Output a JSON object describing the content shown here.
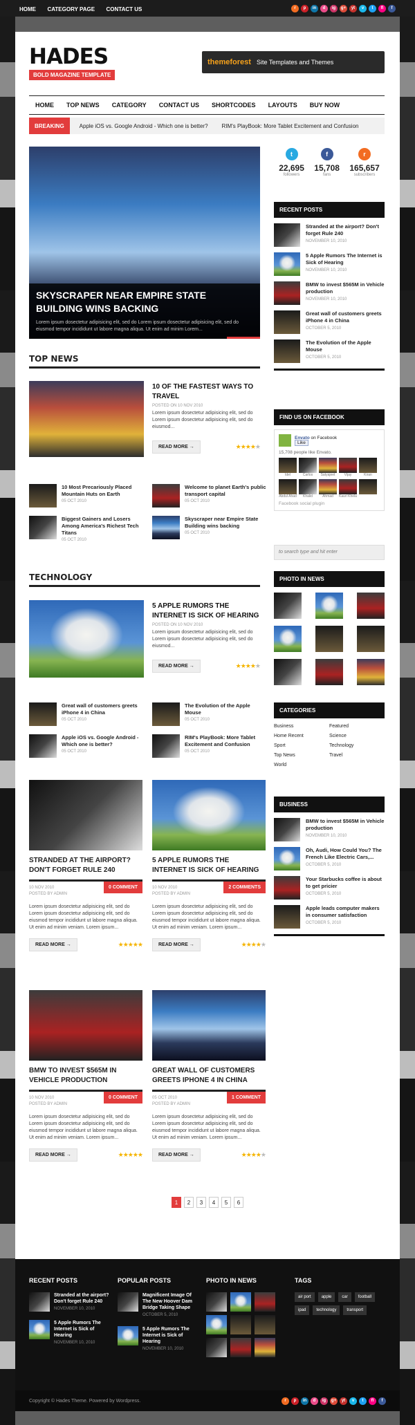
{
  "topbar": {
    "links": [
      "HOME",
      "CATEGORY PAGE",
      "CONTACT US"
    ]
  },
  "social_icons": [
    {
      "name": "rss-icon",
      "glyph": "r",
      "color": "#f26c22"
    },
    {
      "name": "pinterest-icon",
      "glyph": "p",
      "color": "#cb2027"
    },
    {
      "name": "linkedin-icon",
      "glyph": "in",
      "color": "#0e76a8"
    },
    {
      "name": "dribbble-icon",
      "glyph": "d",
      "color": "#ea4c89"
    },
    {
      "name": "instagram-icon",
      "glyph": "ig",
      "color": "#cc3366"
    },
    {
      "name": "googleplus-icon",
      "glyph": "g+",
      "color": "#dd4b39"
    },
    {
      "name": "youtube-icon",
      "glyph": "yt",
      "color": "#c4302b"
    },
    {
      "name": "vimeo-icon",
      "glyph": "v",
      "color": "#1ab7ea"
    },
    {
      "name": "twitter-icon",
      "glyph": "t",
      "color": "#1da1f2"
    },
    {
      "name": "flickr-icon",
      "glyph": "fl",
      "color": "#ff0084"
    },
    {
      "name": "facebook-icon",
      "glyph": "f",
      "color": "#3b5998"
    }
  ],
  "logo": {
    "title": "HADES",
    "tagline": "BOLD MAGAZINE TEMPLATE"
  },
  "banner": {
    "brand": "themeforest",
    "text": "Site Templates and Themes"
  },
  "nav": [
    "HOME",
    "TOP NEWS",
    "CATEGORY",
    "CONTACT US",
    "SHORTCODES",
    "LAYOUTS",
    "BUY NOW"
  ],
  "breaking": {
    "label": "BREAKING",
    "items": [
      "Apple iOS vs. Google Android - Which one is better?",
      "RIM's PlayBook: More Tablet Excitement and Confusion"
    ]
  },
  "hero": {
    "title": "SKYSCRAPER NEAR EMPIRE STATE BUILDING WINS BACKING",
    "text": "Lorem ipsum dosectetur adipisicing elit, sed do Lorem ipsum dosectetur adipisicing elit, sed do eiusmod tempor incididunt ut labore magna aliqua. Ut enim ad minim Lorem..."
  },
  "counts": [
    {
      "icon": "t",
      "value": "22,695",
      "label": "followers",
      "color": "#29a9e1"
    },
    {
      "icon": "f",
      "value": "15,708",
      "label": "fans",
      "color": "#3b5998"
    },
    {
      "icon": "r",
      "value": "165,657",
      "label": "subscribers",
      "color": "#f26c22"
    }
  ],
  "top_news": {
    "heading": "TOP NEWS",
    "feature": {
      "title": "10 OF THE FASTEST WAYS TO TRAVEL",
      "date": "POSTED ON 10 NOV 2010",
      "text": "Lorem ipsum dosectetur adipisicing elit, sed do Lorem ipsum dosectetur adipisicing elit, sed do eiusmod...",
      "readmore": "READ MORE →",
      "rating": 4
    },
    "minis": [
      {
        "title": "10 Most Precariously Placed Mountain Huts on Earth",
        "date": "05 OCT 2010"
      },
      {
        "title": "Welcome to planet Earth's public transport capital",
        "date": "05 OCT 2010"
      },
      {
        "title": "Biggest Gainers and Losers Among America's Richest Tech Titans",
        "date": "05 OCT 2010"
      },
      {
        "title": "Skyscraper near Empire State Building wins backing",
        "date": "05 OCT 2010"
      }
    ]
  },
  "technology": {
    "heading": "TECHNOLOGY",
    "feature": {
      "title": "5 APPLE RUMORS THE INTERNET IS SICK OF HEARING",
      "date": "POSTED ON 10 NOV 2010",
      "text": "Lorem ipsum dosectetur adipisicing elit, sed do Lorem ipsum dosectetur adipisicing elit, sed do eiusmod...",
      "readmore": "READ MORE →",
      "rating": 4
    },
    "minis": [
      {
        "title": "Great wall of customers greets iPhone 4 in China",
        "date": "05 OCT 2010"
      },
      {
        "title": "The Evolution of the Apple Mouse",
        "date": "05 OCT 2010"
      },
      {
        "title": "Apple iOS vs. Google Android - Which one is better?",
        "date": "05 OCT 2010"
      },
      {
        "title": "RIM's PlayBook: More Tablet Excitement and Confusion",
        "date": "05 OCT 2010"
      }
    ]
  },
  "cards": [
    {
      "title": "STRANDED AT THE AIRPORT? DON'T FORGET RULE 240",
      "date": "10 NOV 2010",
      "author": "POSTED BY ADMIN",
      "comments": "0 COMMENT",
      "text": "Lorem ipsum dosectetur adipisicing elit, sed do Lorem ipsum dosectetur adipisicing elit, sed do eiusmod tempor incididunt ut labore magna aliqua. Ut enim ad minim veniam. Lorem ipsum...",
      "readmore": "READ MORE →",
      "rating": 5
    },
    {
      "title": "5 APPLE RUMORS THE INTERNET IS SICK OF HEARING",
      "date": "10 NOV 2010",
      "author": "POSTED BY ADMIN",
      "comments": "2 COMMENTS",
      "text": "Lorem ipsum dosectetur adipisicing elit, sed do Lorem ipsum dosectetur adipisicing elit, sed do eiusmod tempor incididunt ut labore magna aliqua. Ut enim ad minim veniam. Lorem ipsum...",
      "readmore": "READ MORE →",
      "rating": 4
    },
    {
      "title": "BMW TO INVEST $565M IN VEHICLE PRODUCTION",
      "date": "10 NOV 2010",
      "author": "POSTED BY ADMIN",
      "comments": "0 COMMENT",
      "text": "Lorem ipsum dosectetur adipisicing elit, sed do Lorem ipsum dosectetur adipisicing elit, sed do eiusmod tempor incididunt ut labore magna aliqua. Ut enim ad minim veniam. Lorem ipsum...",
      "readmore": "READ MORE →",
      "rating": 5
    },
    {
      "title": "GREAT WALL OF CUSTOMERS GREETS IPHONE 4 IN CHINA",
      "date": "05 OCT 2010",
      "author": "POSTED BY ADMIN",
      "comments": "1 COMMENT",
      "text": "Lorem ipsum dosectetur adipisicing elit, sed do Lorem ipsum dosectetur adipisicing elit, sed do eiusmod tempor incididunt ut labore magna aliqua. Ut enim ad minim veniam. Lorem ipsum...",
      "readmore": "READ MORE →",
      "rating": 4
    }
  ],
  "pagination": [
    "1",
    "2",
    "3",
    "4",
    "5",
    "6"
  ],
  "sidebar": {
    "recent": {
      "heading": "RECENT POSTS",
      "items": [
        {
          "title": "Stranded at the airport? Don't forget Rule 240",
          "date": "NOVEMBER 10, 2010"
        },
        {
          "title": "5 Apple Rumors The Internet is Sick of Hearing",
          "date": "NOVEMBER 10, 2010"
        },
        {
          "title": "BMW to invest $565M in Vehicle production",
          "date": "NOVEMBER 10, 2010"
        },
        {
          "title": "Great wall of customers greets iPhone 4 in China",
          "date": "OCTOBER 5, 2010"
        },
        {
          "title": "The Evolution of the Apple Mouse",
          "date": "OCTOBER 5, 2010"
        }
      ]
    },
    "facebook": {
      "heading": "FIND US ON FACEBOOK",
      "page": "Envato",
      "sub": "on Facebook",
      "like": "Like",
      "people": "15,708 people like Envato.",
      "names": [
        "Idel",
        "Carlos",
        "Satyajeet",
        "Vijay",
        "Kiran",
        "Abdul Ahad",
        "Khalid",
        "Ahmad",
        "Kauri Khela",
        ""
      ],
      "plugin": "Facebook social plugin"
    },
    "search": {
      "placeholder": "to search type and hit enter"
    },
    "photos": {
      "heading": "PHOTO IN NEWS"
    },
    "categories": {
      "heading": "CATEGORIES",
      "items": [
        "Business",
        "Featured",
        "Home Recent",
        "Science",
        "Sport",
        "Technology",
        "Top News",
        "Travel",
        "World"
      ]
    },
    "business": {
      "heading": "BUSINESS",
      "items": [
        {
          "title": "BMW to invest $565M in Vehicle production",
          "date": "NOVEMBER 10, 2010"
        },
        {
          "title": "Oh, Audi, How Could You? The French Like Electric Cars,...",
          "date": "OCTOBER 5, 2010"
        },
        {
          "title": "Your Starbucks coffee is about to get pricier",
          "date": "OCTOBER 5, 2010"
        },
        {
          "title": "Apple leads computer makers in consumer satisfaction",
          "date": "OCTOBER 5, 2010"
        }
      ]
    }
  },
  "footer": {
    "recent": {
      "heading": "RECENT POSTS",
      "items": [
        {
          "title": "Stranded at the airport? Don't forget Rule 240",
          "date": "NOVEMBER 10, 2010"
        },
        {
          "title": "5 Apple Rumors The Internet is Sick of Hearing",
          "date": "NOVEMBER 10, 2010"
        }
      ]
    },
    "popular": {
      "heading": "POPULAR POSTS",
      "items": [
        {
          "title": "Magnificent Image Of The New Hoover Dam Bridge Taking Shape",
          "date": "OCTOBER 5, 2010"
        },
        {
          "title": "5 Apple Rumors The Internet is Sick of Hearing",
          "date": "NOVEMBER 10, 2010"
        }
      ]
    },
    "photos": {
      "heading": "PHOTO IN NEWS"
    },
    "tags": {
      "heading": "TAGS",
      "items": [
        "air port",
        "apple",
        "car",
        "football",
        "ipad",
        "technology",
        "transport"
      ]
    },
    "copyright": "Copyright © Hades Theme. Powered by Wordpress."
  }
}
